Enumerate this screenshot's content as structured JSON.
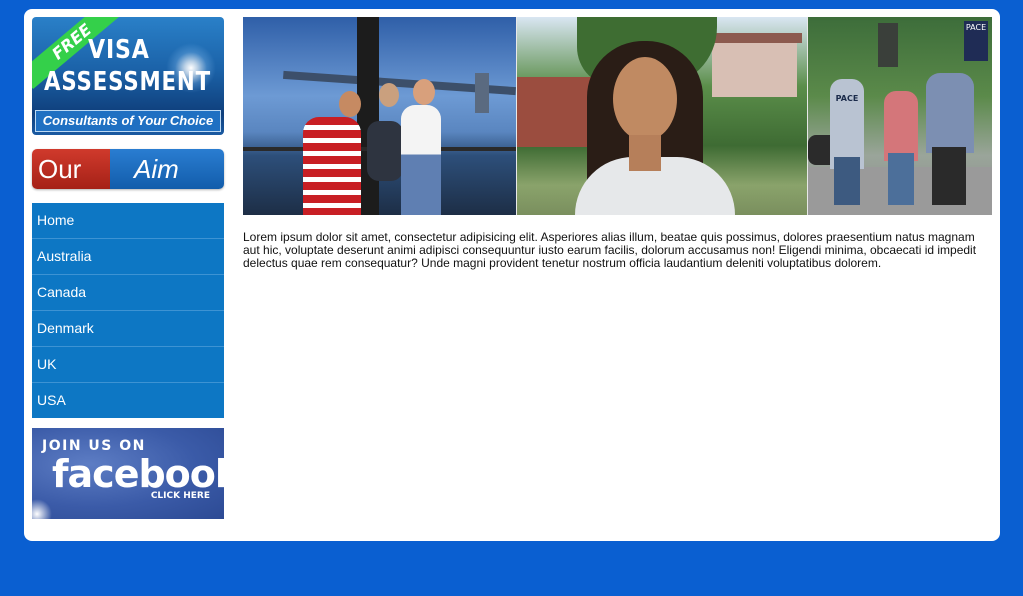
{
  "sidebar": {
    "visa_banner": {
      "ribbon": "FREE",
      "line1": "VISA",
      "line2": "ASSESSMENT",
      "tagline": "Consultants of Your Choice"
    },
    "aim_button": {
      "left": "Our",
      "right": "Aim"
    },
    "nav": [
      {
        "label": "Home"
      },
      {
        "label": "Australia"
      },
      {
        "label": "Canada"
      },
      {
        "label": "Denmark"
      },
      {
        "label": "UK"
      },
      {
        "label": "USA"
      }
    ],
    "facebook_banner": {
      "join": "JOIN US ON",
      "brand": "facebook",
      "cta": "CLICK HERE"
    }
  },
  "main": {
    "hero_sign": "PACE",
    "shirt_text": "PACE",
    "body_text": "Lorem ipsum dolor sit amet, consectetur adipisicing elit. Asperiores alias illum, beatae quis possimus, dolores praesentium natus magnam aut hic, voluptate deserunt animi adipisci consequuntur iusto earum facilis, dolorum accusamus non! Eligendi minima, obcaecati id impedit delectus quae rem consequatur? Unde magni provident tenetur nostrum officia laudantium deleniti voluptatibus dolorem."
  },
  "colors": {
    "background": "#0a5fd1",
    "nav": "#0d77c4",
    "our_red": "#b8291d",
    "aim_blue": "#1b6bbf",
    "facebook_blue": "#3b5ba8"
  }
}
